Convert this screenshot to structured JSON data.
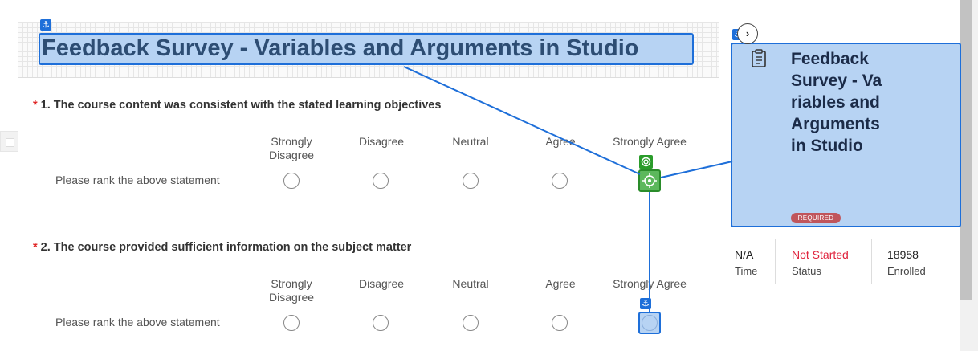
{
  "survey": {
    "title": "Feedback Survey - Variables and Arguments in Studio"
  },
  "scale_options": [
    "Strongly Disagree",
    "Disagree",
    "Neutral",
    "Agree",
    "Strongly Agree"
  ],
  "scale_labels": {
    "strongly_disagree_line1": "Strongly",
    "strongly_disagree_line2": "Disagree",
    "disagree": "Disagree",
    "neutral": "Neutral",
    "agree": "Agree",
    "strongly_agree": "Strongly Agree"
  },
  "questions": [
    {
      "required_mark": "*",
      "text": "1. The course content was consistent with the stated learning objectives",
      "row_label": "Please rank the above statement"
    },
    {
      "required_mark": "*",
      "text": "2. The course provided sufficient information on the subject matter",
      "row_label": "Please rank the above statement"
    }
  ],
  "side_card": {
    "icon": "clipboard-icon",
    "title": "Feedback Survey - Variables and Arguments in Studio",
    "badge": "REQUIRED"
  },
  "stats": {
    "time_value": "N/A",
    "time_label": "Time",
    "status_value": "Not Started",
    "status_label": "Status",
    "enrolled_value": "18958",
    "enrolled_label": "Enrolled"
  },
  "collapse_icon": "chevron-right-icon",
  "colors": {
    "accent_blue": "#1e6fd9",
    "highlight_fill": "#b7d3f3",
    "title_text": "#2d4d73",
    "required_star": "#e02424",
    "status_not_started": "#e0243e",
    "target_green": "#5cb85c",
    "badge_red": "#c0555b"
  }
}
